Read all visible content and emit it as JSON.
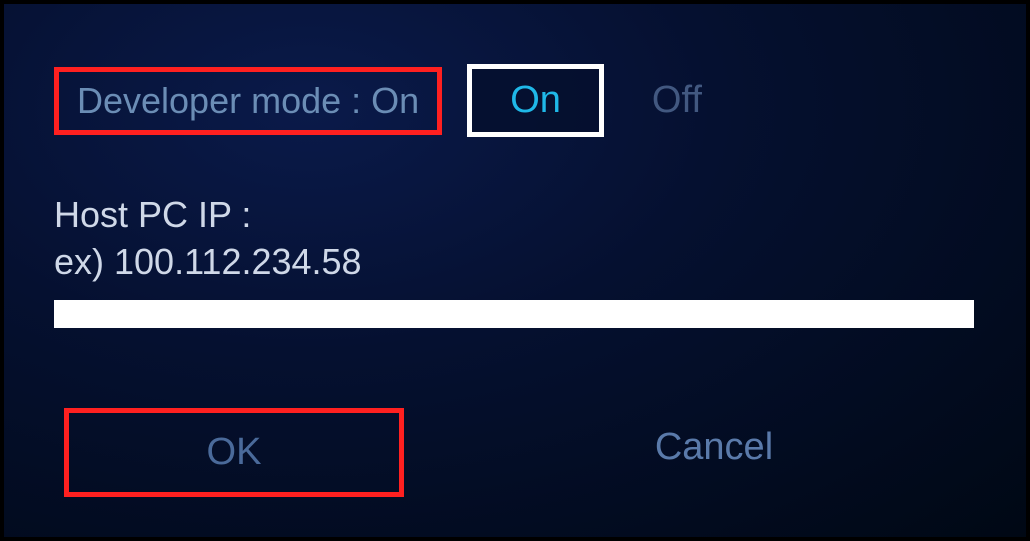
{
  "developer_mode": {
    "label": "Developer mode : On",
    "on_label": "On",
    "off_label": "Off",
    "state": "On"
  },
  "host_ip": {
    "label": "Host PC IP :\nex) 100.112.234.58",
    "value": ""
  },
  "buttons": {
    "ok": "OK",
    "cancel": "Cancel"
  }
}
